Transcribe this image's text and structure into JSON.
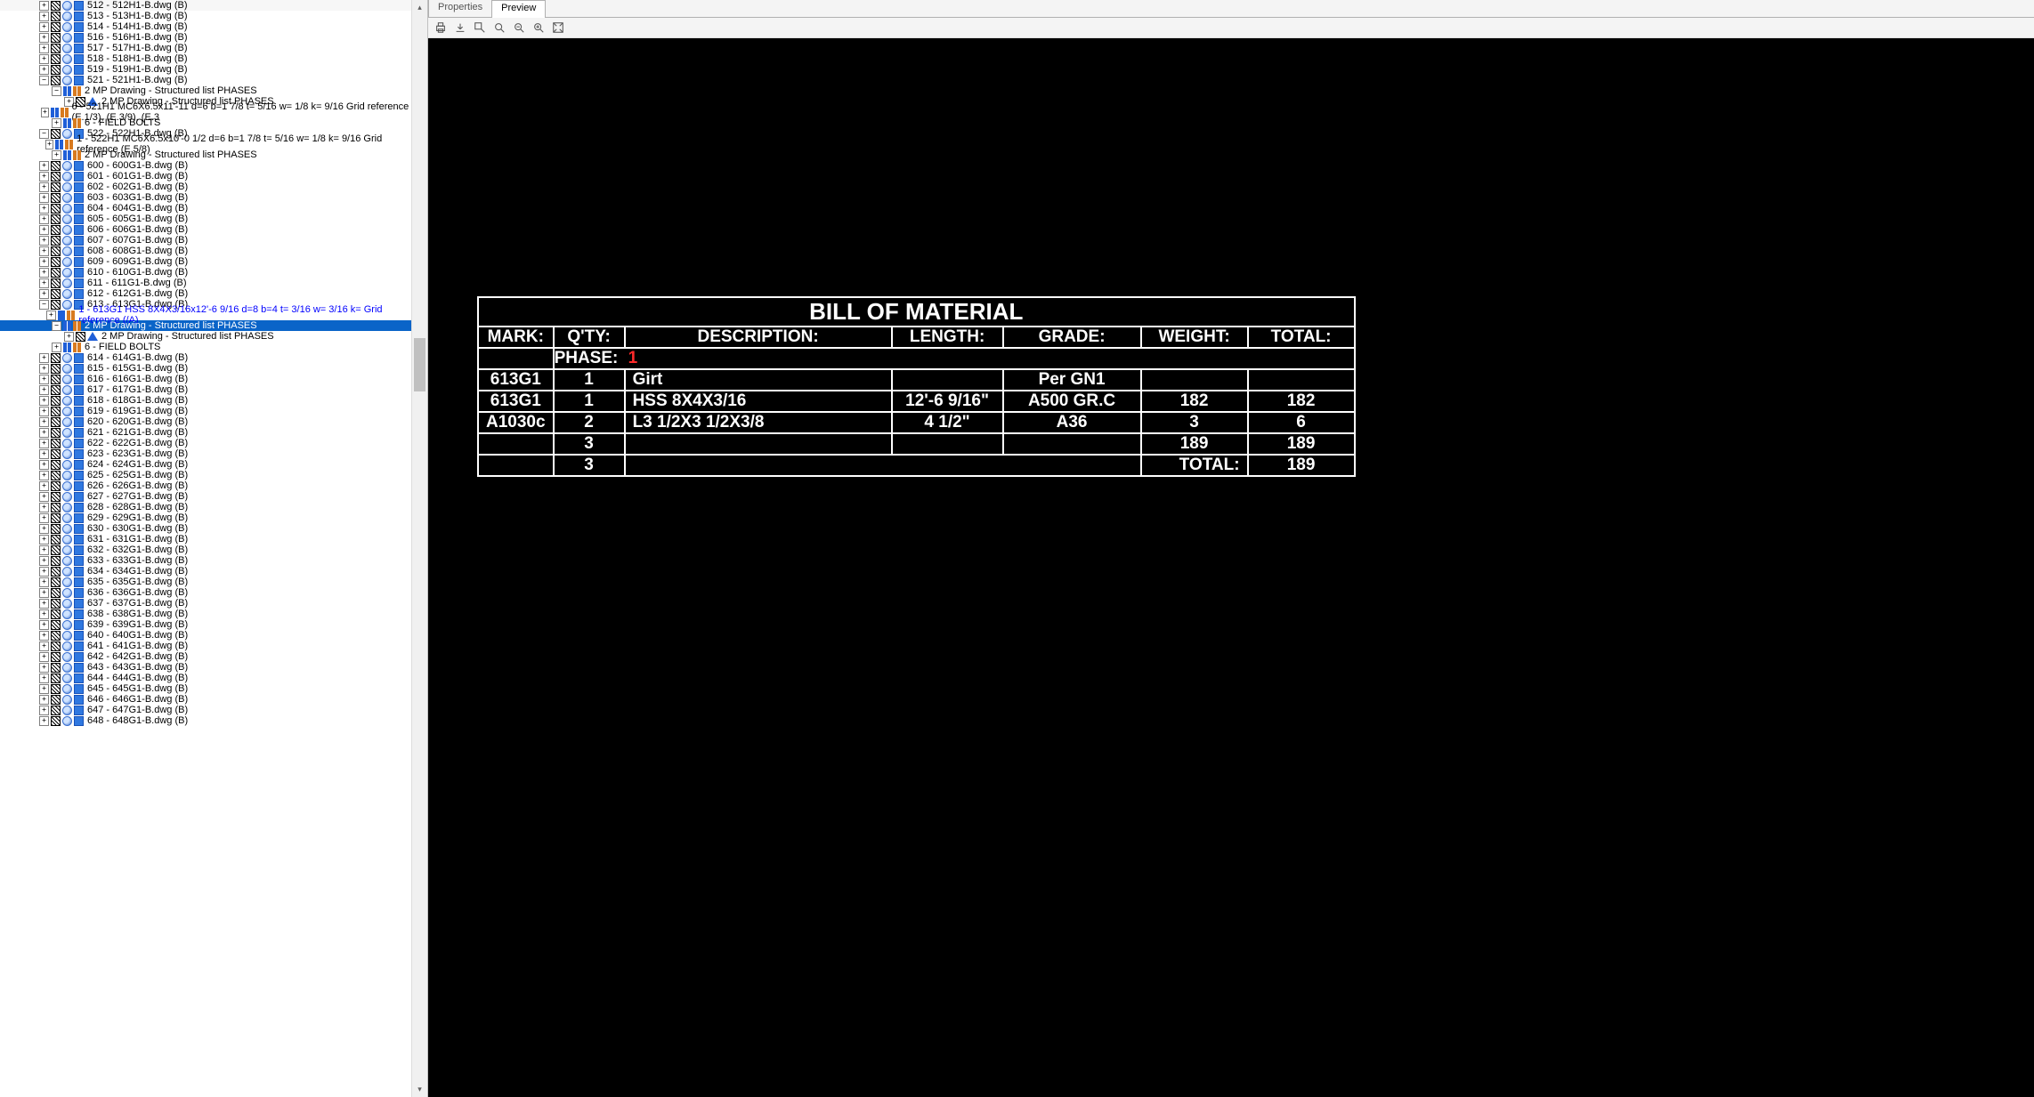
{
  "tabs": {
    "properties": "Properties",
    "preview": "Preview",
    "active": "preview"
  },
  "tree": {
    "baseIndent": 44,
    "step": 14,
    "items": [
      {
        "d": 0,
        "t": "+",
        "ics": [
          "hatch",
          "cirblue",
          "gear"
        ],
        "label": "512 - 512H1-B.dwg (B)"
      },
      {
        "d": 0,
        "t": "+",
        "ics": [
          "hatch",
          "cirblue",
          "gear"
        ],
        "label": "513 - 513H1-B.dwg (B)"
      },
      {
        "d": 0,
        "t": "+",
        "ics": [
          "hatch",
          "cirblue",
          "gear"
        ],
        "label": "514 - 514H1-B.dwg (B)"
      },
      {
        "d": 0,
        "t": "+",
        "ics": [
          "hatch",
          "cirblue",
          "gear"
        ],
        "label": "516 - 516H1-B.dwg (B)"
      },
      {
        "d": 0,
        "t": "+",
        "ics": [
          "hatch",
          "cirblue",
          "gear"
        ],
        "label": "517 - 517H1-B.dwg (B)"
      },
      {
        "d": 0,
        "t": "+",
        "ics": [
          "hatch",
          "cirblue",
          "gear"
        ],
        "label": "518 - 518H1-B.dwg (B)"
      },
      {
        "d": 0,
        "t": "+",
        "ics": [
          "hatch",
          "cirblue",
          "gear"
        ],
        "label": "519 - 519H1-B.dwg (B)"
      },
      {
        "d": 0,
        "t": "-",
        "ics": [
          "hatch",
          "cirblue",
          "gear"
        ],
        "label": "521 - 521H1-B.dwg (B)"
      },
      {
        "d": 1,
        "t": "-",
        "ics": [
          "colblue",
          "colorange"
        ],
        "label": "2 MP Drawing - Structured list PHASES"
      },
      {
        "d": 2,
        "t": "+",
        "ics": [
          "hatch",
          "tri"
        ],
        "label": "2 MP Drawing - Structured list PHASES"
      },
      {
        "d": 1,
        "t": "+",
        "ics": [
          "colblue",
          "colorange"
        ],
        "label": "6 - 521H1 MC6X6.5x11'-11 d=6 b=1 7/8 t= 5/16 w= 1/8 k= 9/16 Grid reference (E.1/3), (E.3/9), (E.3"
      },
      {
        "d": 1,
        "t": "+",
        "ics": [
          "colblue",
          "colorange"
        ],
        "label": "6 - FIELD BOLTS"
      },
      {
        "d": 0,
        "t": "-",
        "ics": [
          "hatch",
          "cirblue",
          "gear"
        ],
        "label": "522 - 522H1-B.dwg (B)"
      },
      {
        "d": 1,
        "t": "+",
        "ics": [
          "colblue",
          "colorange"
        ],
        "label": "1 - 522H1 MC6X6.5x10'-0 1/2 d=6 b=1 7/8 t= 5/16 w= 1/8 k= 9/16 Grid reference (E.5/8)"
      },
      {
        "d": 1,
        "t": "+",
        "ics": [
          "colblue",
          "colorange"
        ],
        "label": "2 MP Drawing - Structured list PHASES"
      },
      {
        "d": 0,
        "t": "+",
        "ics": [
          "hatch",
          "cirblue",
          "gear"
        ],
        "label": "600 - 600G1-B.dwg (B)"
      },
      {
        "d": 0,
        "t": "+",
        "ics": [
          "hatch",
          "cirblue",
          "gear"
        ],
        "label": "601 - 601G1-B.dwg (B)"
      },
      {
        "d": 0,
        "t": "+",
        "ics": [
          "hatch",
          "cirblue",
          "gear"
        ],
        "label": "602 - 602G1-B.dwg (B)"
      },
      {
        "d": 0,
        "t": "+",
        "ics": [
          "hatch",
          "cirblue",
          "gear"
        ],
        "label": "603 - 603G1-B.dwg (B)"
      },
      {
        "d": 0,
        "t": "+",
        "ics": [
          "hatch",
          "cirblue",
          "gear"
        ],
        "label": "604 - 604G1-B.dwg (B)"
      },
      {
        "d": 0,
        "t": "+",
        "ics": [
          "hatch",
          "cirblue",
          "gear"
        ],
        "label": "605 - 605G1-B.dwg (B)"
      },
      {
        "d": 0,
        "t": "+",
        "ics": [
          "hatch",
          "cirblue",
          "gear"
        ],
        "label": "606 - 606G1-B.dwg (B)"
      },
      {
        "d": 0,
        "t": "+",
        "ics": [
          "hatch",
          "cirblue",
          "gear"
        ],
        "label": "607 - 607G1-B.dwg (B)"
      },
      {
        "d": 0,
        "t": "+",
        "ics": [
          "hatch",
          "cirblue",
          "gear"
        ],
        "label": "608 - 608G1-B.dwg (B)"
      },
      {
        "d": 0,
        "t": "+",
        "ics": [
          "hatch",
          "cirblue",
          "gear"
        ],
        "label": "609 - 609G1-B.dwg (B)"
      },
      {
        "d": 0,
        "t": "+",
        "ics": [
          "hatch",
          "cirblue",
          "gear"
        ],
        "label": "610 - 610G1-B.dwg (B)"
      },
      {
        "d": 0,
        "t": "+",
        "ics": [
          "hatch",
          "cirblue",
          "gear"
        ],
        "label": "611 - 611G1-B.dwg (B)"
      },
      {
        "d": 0,
        "t": "+",
        "ics": [
          "hatch",
          "cirblue",
          "gear"
        ],
        "label": "612 - 612G1-B.dwg (B)"
      },
      {
        "d": 0,
        "t": "-",
        "ics": [
          "hatch",
          "cirblue",
          "gear"
        ],
        "label": "613 - 613G1-B.dwg (B)"
      },
      {
        "d": 1,
        "t": "+",
        "ics": [
          "colblue",
          "colorange"
        ],
        "label": "1 - 613G1 HSS 8X4X3/16x12'-6 9/16 d=8 b=4 t= 3/16 w= 3/16 k= Grid reference (/A)",
        "blue": true
      },
      {
        "d": 1,
        "t": "-",
        "ics": [
          "colblue",
          "colorange"
        ],
        "label": "2 MP Drawing - Structured list PHASES",
        "selected": true
      },
      {
        "d": 2,
        "t": "+",
        "ics": [
          "hatch",
          "tri"
        ],
        "label": "2 MP Drawing - Structured list PHASES"
      },
      {
        "d": 1,
        "t": "+",
        "ics": [
          "colblue",
          "colorange"
        ],
        "label": "6 - FIELD BOLTS"
      },
      {
        "d": 0,
        "t": "+",
        "ics": [
          "hatch",
          "cirblue",
          "gear"
        ],
        "label": "614 - 614G1-B.dwg (B)"
      },
      {
        "d": 0,
        "t": "+",
        "ics": [
          "hatch",
          "cirblue",
          "gear"
        ],
        "label": "615 - 615G1-B.dwg (B)"
      },
      {
        "d": 0,
        "t": "+",
        "ics": [
          "hatch",
          "cirblue",
          "gear"
        ],
        "label": "616 - 616G1-B.dwg (B)"
      },
      {
        "d": 0,
        "t": "+",
        "ics": [
          "hatch",
          "cirblue",
          "gear"
        ],
        "label": "617 - 617G1-B.dwg (B)"
      },
      {
        "d": 0,
        "t": "+",
        "ics": [
          "hatch",
          "cirblue",
          "gear"
        ],
        "label": "618 - 618G1-B.dwg (B)"
      },
      {
        "d": 0,
        "t": "+",
        "ics": [
          "hatch",
          "cirblue",
          "gear"
        ],
        "label": "619 - 619G1-B.dwg (B)"
      },
      {
        "d": 0,
        "t": "+",
        "ics": [
          "hatch",
          "cirblue",
          "gear"
        ],
        "label": "620 - 620G1-B.dwg (B)"
      },
      {
        "d": 0,
        "t": "+",
        "ics": [
          "hatch",
          "cirblue",
          "gear"
        ],
        "label": "621 - 621G1-B.dwg (B)"
      },
      {
        "d": 0,
        "t": "+",
        "ics": [
          "hatch",
          "cirblue",
          "gear"
        ],
        "label": "622 - 622G1-B.dwg (B)"
      },
      {
        "d": 0,
        "t": "+",
        "ics": [
          "hatch",
          "cirblue",
          "gear"
        ],
        "label": "623 - 623G1-B.dwg (B)"
      },
      {
        "d": 0,
        "t": "+",
        "ics": [
          "hatch",
          "cirblue",
          "gear"
        ],
        "label": "624 - 624G1-B.dwg (B)"
      },
      {
        "d": 0,
        "t": "+",
        "ics": [
          "hatch",
          "cirblue",
          "gear"
        ],
        "label": "625 - 625G1-B.dwg (B)"
      },
      {
        "d": 0,
        "t": "+",
        "ics": [
          "hatch",
          "cirblue",
          "gear"
        ],
        "label": "626 - 626G1-B.dwg (B)"
      },
      {
        "d": 0,
        "t": "+",
        "ics": [
          "hatch",
          "cirblue",
          "gear"
        ],
        "label": "627 - 627G1-B.dwg (B)"
      },
      {
        "d": 0,
        "t": "+",
        "ics": [
          "hatch",
          "cirblue",
          "gear"
        ],
        "label": "628 - 628G1-B.dwg (B)"
      },
      {
        "d": 0,
        "t": "+",
        "ics": [
          "hatch",
          "cirblue",
          "gear"
        ],
        "label": "629 - 629G1-B.dwg (B)"
      },
      {
        "d": 0,
        "t": "+",
        "ics": [
          "hatch",
          "cirblue",
          "gear"
        ],
        "label": "630 - 630G1-B.dwg (B)"
      },
      {
        "d": 0,
        "t": "+",
        "ics": [
          "hatch",
          "cirblue",
          "gear"
        ],
        "label": "631 - 631G1-B.dwg (B)"
      },
      {
        "d": 0,
        "t": "+",
        "ics": [
          "hatch",
          "cirblue",
          "gear"
        ],
        "label": "632 - 632G1-B.dwg (B)"
      },
      {
        "d": 0,
        "t": "+",
        "ics": [
          "hatch",
          "cirblue",
          "gear"
        ],
        "label": "633 - 633G1-B.dwg (B)"
      },
      {
        "d": 0,
        "t": "+",
        "ics": [
          "hatch",
          "cirblue",
          "gear"
        ],
        "label": "634 - 634G1-B.dwg (B)"
      },
      {
        "d": 0,
        "t": "+",
        "ics": [
          "hatch",
          "cirblue",
          "gear"
        ],
        "label": "635 - 635G1-B.dwg (B)"
      },
      {
        "d": 0,
        "t": "+",
        "ics": [
          "hatch",
          "cirblue",
          "gear"
        ],
        "label": "636 - 636G1-B.dwg (B)"
      },
      {
        "d": 0,
        "t": "+",
        "ics": [
          "hatch",
          "cirblue",
          "gear"
        ],
        "label": "637 - 637G1-B.dwg (B)"
      },
      {
        "d": 0,
        "t": "+",
        "ics": [
          "hatch",
          "cirblue",
          "gear"
        ],
        "label": "638 - 638G1-B.dwg (B)"
      },
      {
        "d": 0,
        "t": "+",
        "ics": [
          "hatch",
          "cirblue",
          "gear"
        ],
        "label": "639 - 639G1-B.dwg (B)"
      },
      {
        "d": 0,
        "t": "+",
        "ics": [
          "hatch",
          "cirblue",
          "gear"
        ],
        "label": "640 - 640G1-B.dwg (B)"
      },
      {
        "d": 0,
        "t": "+",
        "ics": [
          "hatch",
          "cirblue",
          "gear"
        ],
        "label": "641 - 641G1-B.dwg (B)"
      },
      {
        "d": 0,
        "t": "+",
        "ics": [
          "hatch",
          "cirblue",
          "gear"
        ],
        "label": "642 - 642G1-B.dwg (B)"
      },
      {
        "d": 0,
        "t": "+",
        "ics": [
          "hatch",
          "cirblue",
          "gear"
        ],
        "label": "643 - 643G1-B.dwg (B)"
      },
      {
        "d": 0,
        "t": "+",
        "ics": [
          "hatch",
          "cirblue",
          "gear"
        ],
        "label": "644 - 644G1-B.dwg (B)"
      },
      {
        "d": 0,
        "t": "+",
        "ics": [
          "hatch",
          "cirblue",
          "gear"
        ],
        "label": "645 - 645G1-B.dwg (B)"
      },
      {
        "d": 0,
        "t": "+",
        "ics": [
          "hatch",
          "cirblue",
          "gear"
        ],
        "label": "646 - 646G1-B.dwg (B)"
      },
      {
        "d": 0,
        "t": "+",
        "ics": [
          "hatch",
          "cirblue",
          "gear"
        ],
        "label": "647 - 647G1-B.dwg (B)"
      },
      {
        "d": 0,
        "t": "+",
        "ics": [
          "hatch",
          "cirblue",
          "gear"
        ],
        "label": "648 - 648G1-B.dwg (B)"
      }
    ]
  },
  "bom": {
    "title": "BILL OF MATERIAL",
    "headers": {
      "mark": "MARK:",
      "qty": "Q'TY:",
      "desc": "DESCRIPTION:",
      "len": "LENGTH:",
      "grade": "GRADE:",
      "wt": "WEIGHT:",
      "tot": "TOTAL:"
    },
    "phase_label": "PHASE:",
    "phase_value": "1",
    "rows": [
      {
        "mark": "613G1",
        "qty": "1",
        "desc": "Girt",
        "len": "",
        "grade": "Per GN1",
        "wt": "",
        "tot": ""
      },
      {
        "mark": "613G1",
        "qty": "1",
        "desc": "HSS 8X4X3/16",
        "len": "12'-6 9/16\"",
        "grade": "A500 GR.C",
        "wt": "182",
        "tot": "182"
      },
      {
        "mark": "A1030c",
        "qty": "2",
        "desc": "L3 1/2X3 1/2X3/8",
        "len": "4 1/2\"",
        "grade": "A36",
        "wt": "3",
        "tot": "6"
      },
      {
        "mark": "",
        "qty": "3",
        "desc": "",
        "len": "",
        "grade": "",
        "wt": "189",
        "tot": "189"
      }
    ],
    "footer": {
      "qty": "3",
      "total_label": "TOTAL:",
      "total": "189"
    }
  }
}
